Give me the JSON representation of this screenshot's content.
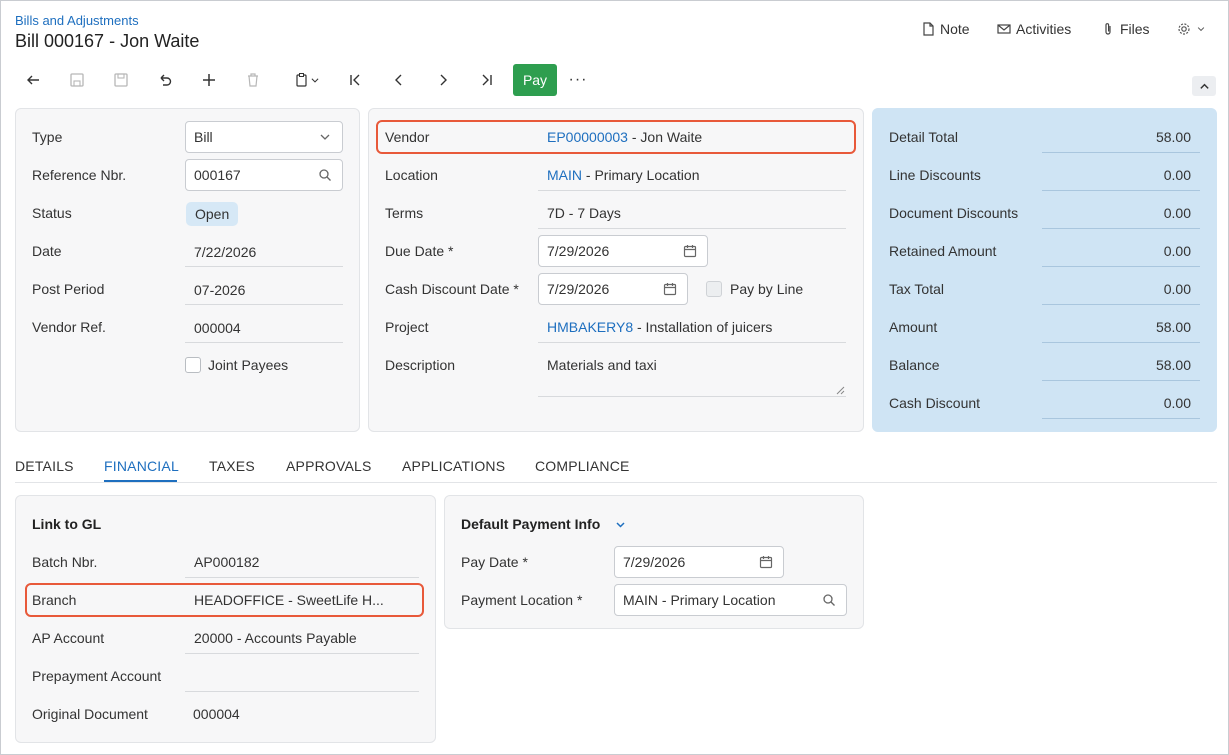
{
  "header": {
    "breadcrumb": "Bills and Adjustments",
    "title": "Bill 000167 - Jon Waite",
    "note_label": "Note",
    "activities_label": "Activities",
    "files_label": "Files"
  },
  "toolbar": {
    "pay_label": "Pay",
    "more_label": "···"
  },
  "summary": {
    "type_label": "Type",
    "type_value": "Bill",
    "ref_label": "Reference Nbr.",
    "ref_value": "000167",
    "status_label": "Status",
    "status_value": "Open",
    "date_label": "Date",
    "date_value": "7/22/2026",
    "post_period_label": "Post Period",
    "post_period_value": "07-2026",
    "vendor_ref_label": "Vendor Ref.",
    "vendor_ref_value": "000004",
    "joint_payees_label": "Joint Payees"
  },
  "vendor": {
    "vendor_label": "Vendor",
    "vendor_id": "EP00000003",
    "vendor_name": " - Jon Waite",
    "location_label": "Location",
    "location_id": "MAIN",
    "location_name": " - Primary Location",
    "terms_label": "Terms",
    "terms_value": "7D - 7 Days",
    "due_date_label": "Due Date *",
    "due_date_value": "7/29/2026",
    "cash_discount_date_label": "Cash Discount Date *",
    "cash_discount_date_value": "7/29/2026",
    "pay_by_line_label": "Pay by Line",
    "project_label": "Project",
    "project_id": "HMBAKERY8",
    "project_name": " - Installation of juicers",
    "description_label": "Description",
    "description_value": "Materials and taxi"
  },
  "totals": {
    "detail_total_label": "Detail Total",
    "detail_total_value": "58.00",
    "line_discounts_label": "Line Discounts",
    "line_discounts_value": "0.00",
    "document_discounts_label": "Document Discounts",
    "document_discounts_value": "0.00",
    "retained_amount_label": "Retained Amount",
    "retained_amount_value": "0.00",
    "tax_total_label": "Tax Total",
    "tax_total_value": "0.00",
    "amount_label": "Amount",
    "amount_value": "58.00",
    "balance_label": "Balance",
    "balance_value": "58.00",
    "cash_discount_label": "Cash Discount",
    "cash_discount_value": "0.00"
  },
  "tabs": [
    "DETAILS",
    "FINANCIAL",
    "TAXES",
    "APPROVALS",
    "APPLICATIONS",
    "COMPLIANCE"
  ],
  "link_to_gl": {
    "title": "Link to GL",
    "batch_label": "Batch Nbr.",
    "batch_value": "AP000182",
    "branch_label": "Branch",
    "branch_value": "HEADOFFICE - SweetLife H...",
    "ap_account_label": "AP Account",
    "ap_account_value": "20000 - Accounts Payable",
    "prepayment_label": "Prepayment Account",
    "prepayment_value": "",
    "original_doc_label": "Original Document",
    "original_doc_value": "000004"
  },
  "payment_info": {
    "title": "Default Payment Info",
    "pay_date_label": "Pay Date *",
    "pay_date_value": "7/29/2026",
    "payment_location_label": "Payment Location *",
    "payment_location_value": "MAIN - Primary Location"
  },
  "colors": {
    "accent": "#1e6fbf",
    "pay_button": "#2e9e4f",
    "highlight": "#e8593a",
    "totals_panel": "#cfe4f4"
  }
}
